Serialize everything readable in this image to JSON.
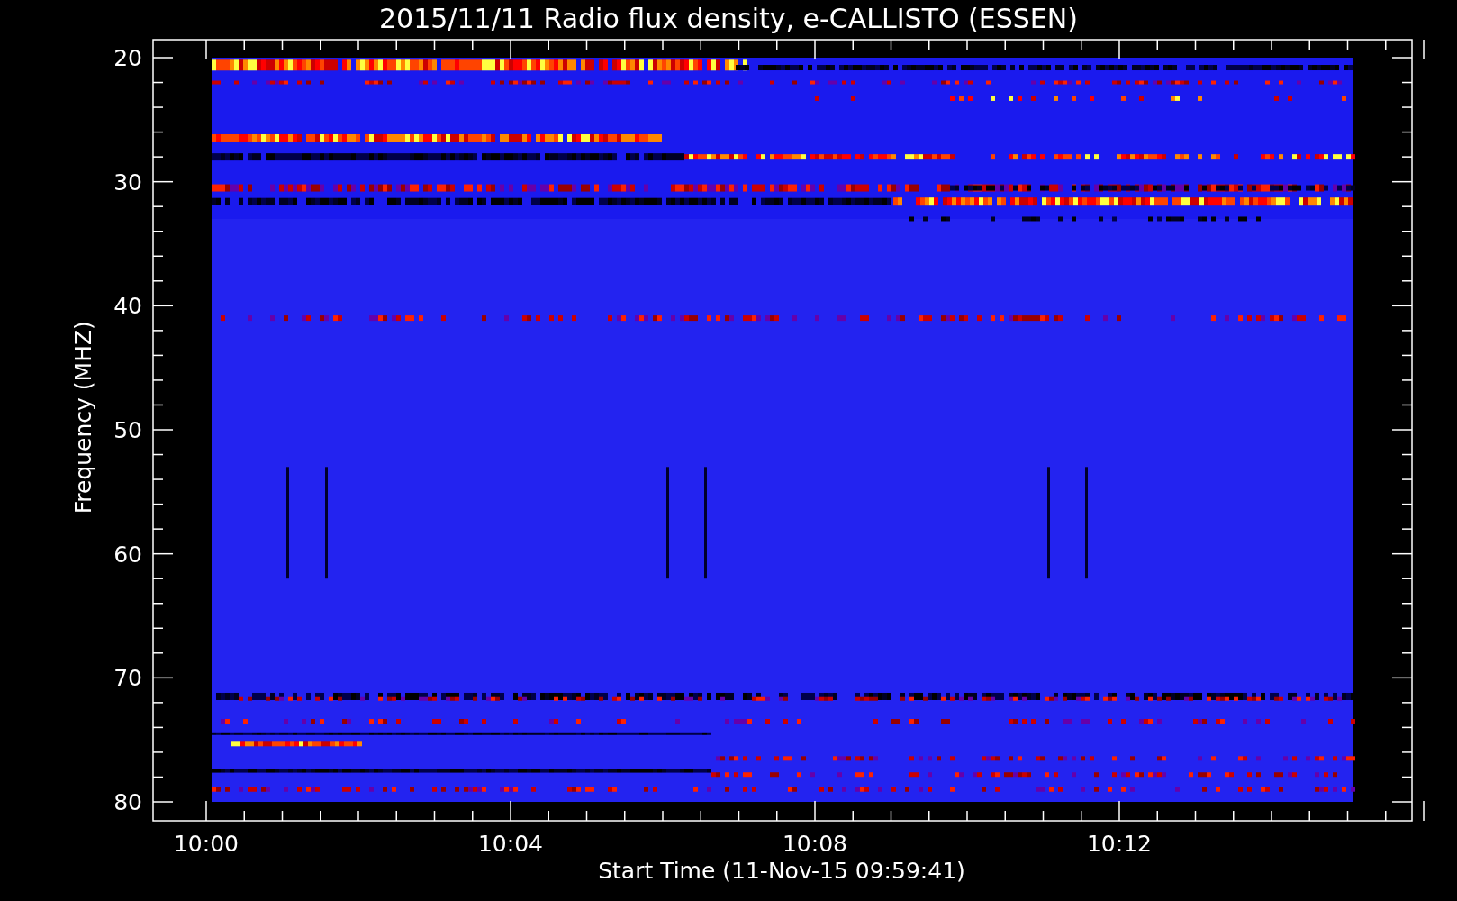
{
  "title": "2015/11/11  Radio flux density, e-CALLISTO (ESSEN)",
  "y_axis": {
    "label": "Frequency (MHZ)",
    "ticks": [
      "20",
      "30",
      "40",
      "50",
      "60",
      "70",
      "80"
    ]
  },
  "x_axis": {
    "label": "Start Time (11-Nov-15 09:59:41)",
    "ticks": [
      "10:00",
      "10:04",
      "10:08",
      "10:12"
    ]
  }
}
